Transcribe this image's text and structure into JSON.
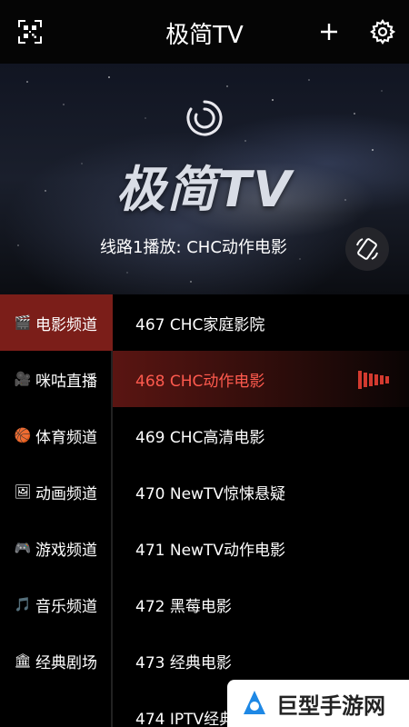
{
  "app": {
    "title": "极简TV"
  },
  "topbar": {
    "qr_icon": "qr-scan-icon",
    "add_icon": "plus-icon",
    "settings_icon": "gear-icon"
  },
  "hero": {
    "logo_text": "极简TV",
    "now_playing": "线路1播放: CHC动作电影",
    "rotate_icon": "screen-rotate-icon"
  },
  "categories": [
    {
      "emoji": "🎬",
      "label": "电影频道",
      "active": true
    },
    {
      "emoji": "🎥",
      "label": "咪咕直播",
      "active": false
    },
    {
      "emoji": "🏀",
      "label": "体育频道",
      "active": false
    },
    {
      "emoji": "🖼",
      "label": "动画频道",
      "active": false
    },
    {
      "emoji": "🎮",
      "label": "游戏频道",
      "active": false
    },
    {
      "emoji": "🎵",
      "label": "音乐频道",
      "active": false
    },
    {
      "emoji": "🏛",
      "label": "经典剧场",
      "active": false
    }
  ],
  "channels": [
    {
      "label": "467 CHC家庭影院",
      "active": false
    },
    {
      "label": "468 CHC动作电影",
      "active": true
    },
    {
      "label": "469 CHC高清电影",
      "active": false
    },
    {
      "label": "470 NewTV惊悚悬疑",
      "active": false
    },
    {
      "label": "471 NewTV动作电影",
      "active": false
    },
    {
      "label": "472 黑莓电影",
      "active": false
    },
    {
      "label": "473 经典电影",
      "active": false
    },
    {
      "label": "474 IPTV经典",
      "active": false
    }
  ],
  "watermark": {
    "text": "巨型手游网"
  },
  "colors": {
    "accent": "#7b1e19",
    "active_text": "#ff5a4e",
    "background": "#000000"
  }
}
